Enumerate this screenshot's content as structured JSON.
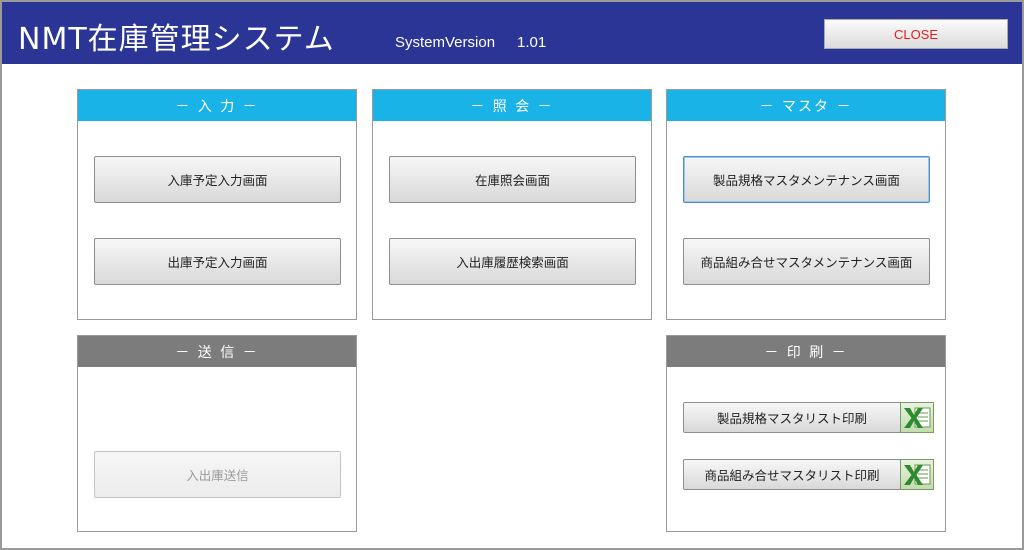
{
  "header": {
    "title": "NMT在庫管理システム",
    "system_version_label": "SystemVersion",
    "system_version": "1.01",
    "close_label": "CLOSE"
  },
  "panels": {
    "input": {
      "title": "－ 入 力 －",
      "buttons": [
        "入庫予定入力画面",
        "出庫予定入力画面"
      ]
    },
    "inquiry": {
      "title": "－ 照 会 －",
      "buttons": [
        "在庫照会画面",
        "入出庫履歴検索画面"
      ]
    },
    "master": {
      "title": "－ マスタ －",
      "buttons": [
        "製品規格マスタメンテナンス画面",
        "商品組み合せマスタメンテナンス画面"
      ]
    },
    "send": {
      "title": "－ 送 信 －",
      "buttons": [
        "入出庫送信"
      ]
    },
    "print": {
      "title": "－ 印 刷 －",
      "buttons": [
        "製品規格マスタリスト印刷",
        "商品組み合せマスタリスト印刷"
      ]
    }
  },
  "colors": {
    "header_bg": "#2b3595",
    "panel_head_active": "#1ab3e8",
    "panel_head_inactive": "#7c7c7c",
    "close_text": "#e02020"
  },
  "icons": {
    "excel": "excel-icon"
  }
}
